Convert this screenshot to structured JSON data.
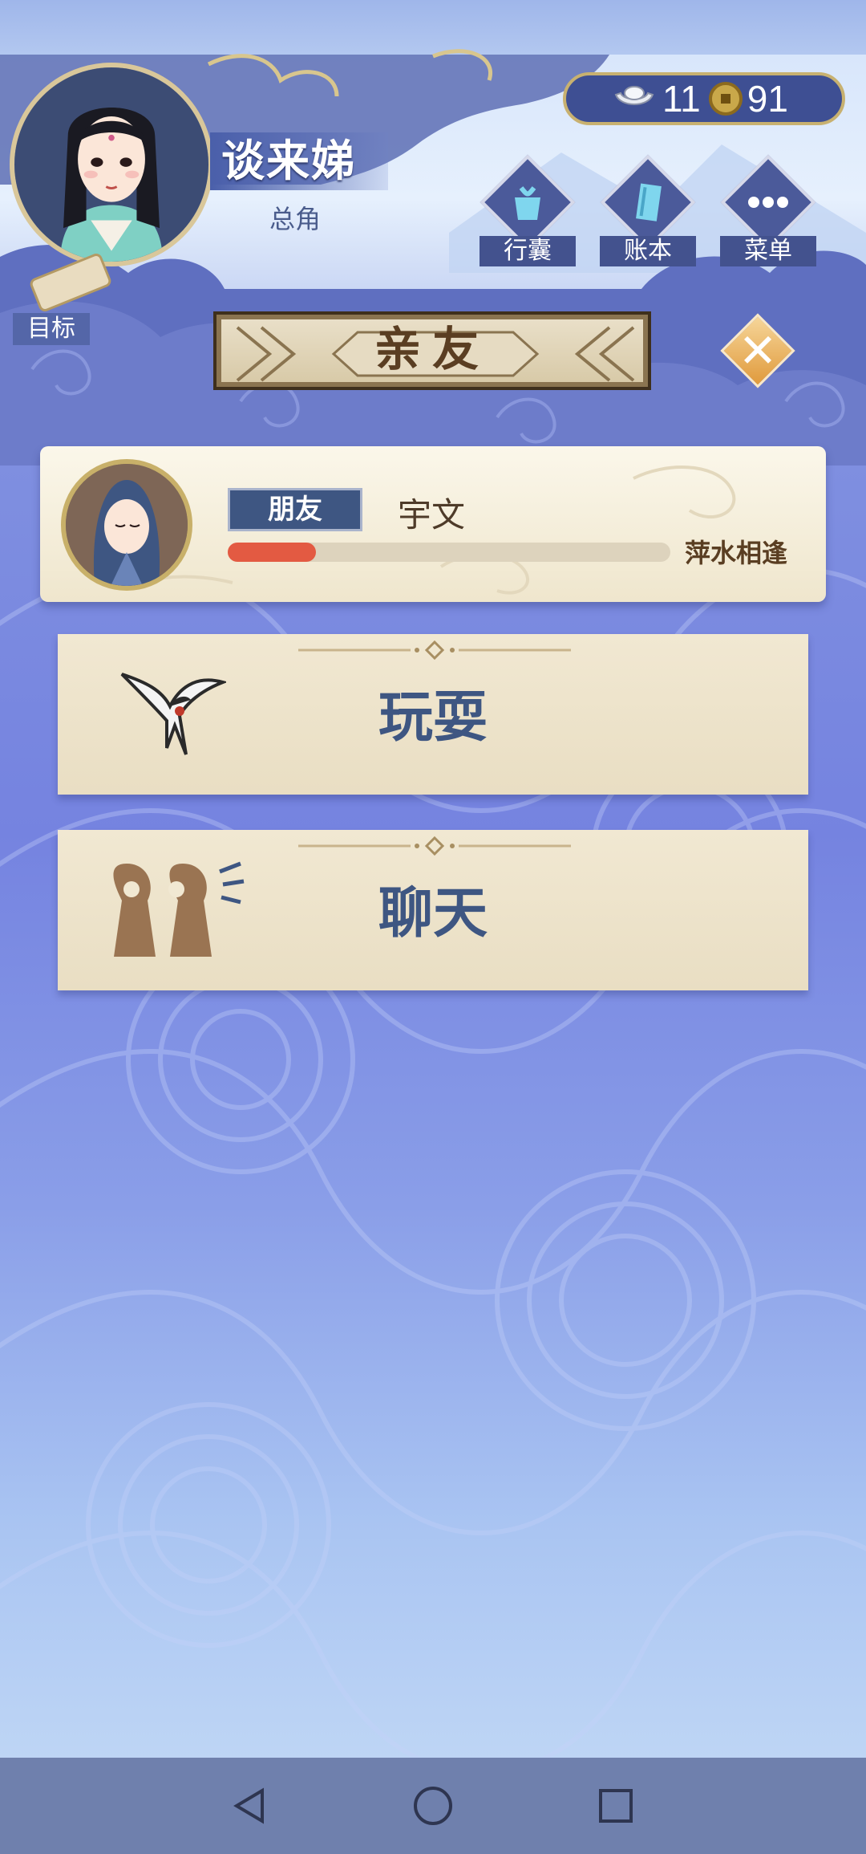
{
  "player": {
    "name": "谈来娣",
    "role": "总角"
  },
  "currency": {
    "silver": "11",
    "coins": "91"
  },
  "menu": [
    {
      "label": "行囊",
      "icon": "bag-icon"
    },
    {
      "label": "账本",
      "icon": "ledger-icon"
    },
    {
      "label": "菜单",
      "icon": "more-icon"
    }
  ],
  "goal": {
    "label": "目标",
    "icon": "scroll-icon"
  },
  "title": "亲友",
  "friend": {
    "tag": "朋友",
    "name": "宇文",
    "status": "萍水相逢",
    "affinity_percent": 20
  },
  "actions": [
    {
      "label": "玩耍",
      "icon": "swallow-icon"
    },
    {
      "label": "聊天",
      "icon": "chat-people-icon"
    }
  ],
  "colors": {
    "accent_blue": "#3e5682",
    "bar_red": "#e35a42",
    "gold": "#c8b170"
  }
}
